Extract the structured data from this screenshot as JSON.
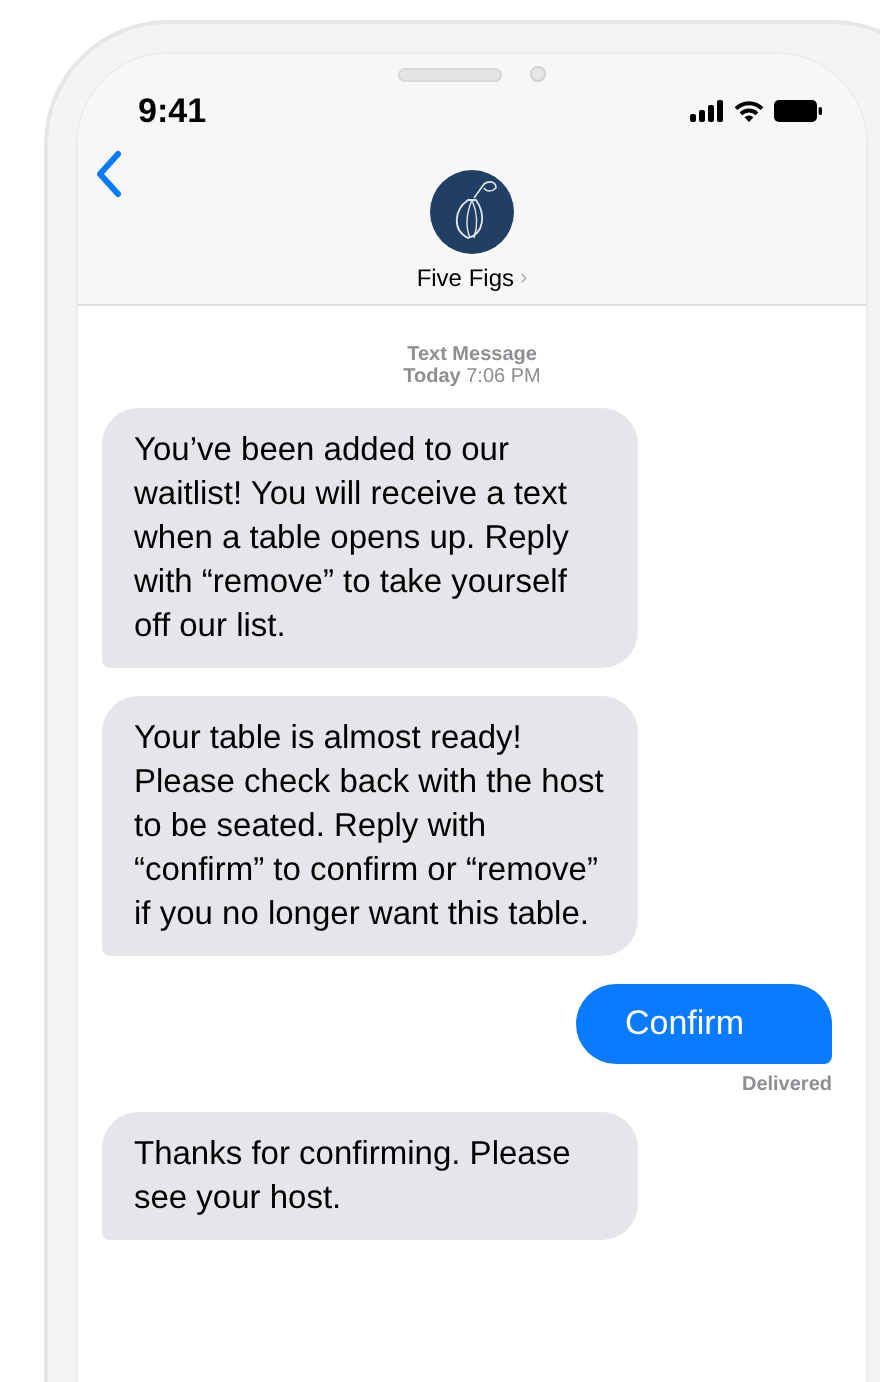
{
  "status_bar": {
    "time": "9:41"
  },
  "header": {
    "contact": "Five Figs",
    "chevron": "›"
  },
  "timestamp": {
    "service": "Text Message",
    "when": "**Today** 7:06 PM"
  },
  "messages": [
    {
      "kind": "incoming",
      "text": "You’ve been added to our waitlist! You will receive a text when a table opens up. Reply with “remove” to take yourself off our list."
    },
    {
      "kind": "incoming",
      "text": "Your table is almost ready! Please check back with the host to be seated. Reply with “confirm” to confirm or “remove” if you no longer want this table."
    },
    {
      "kind": "outgoing",
      "text": "Confirm",
      "status": "Delivered"
    },
    {
      "kind": "incoming",
      "text": "Thanks for confirming. Please see your host."
    }
  ]
}
